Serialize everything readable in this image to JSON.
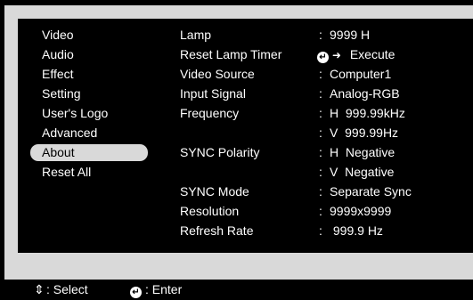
{
  "menu": {
    "items": [
      {
        "label": "Video",
        "active": false
      },
      {
        "label": "Audio",
        "active": false
      },
      {
        "label": "Effect",
        "active": false
      },
      {
        "label": "Setting",
        "active": false
      },
      {
        "label": "User's Logo",
        "active": false
      },
      {
        "label": "Advanced",
        "active": false
      },
      {
        "label": "About",
        "active": true
      },
      {
        "label": "Reset All",
        "active": false
      }
    ]
  },
  "about": {
    "rows": [
      {
        "label": "Lamp",
        "value": "9999 H"
      },
      {
        "label": "Reset Lamp Timer",
        "value": "Execute"
      },
      {
        "label": "Video Source",
        "value": "Computer1"
      },
      {
        "label": "Input Signal",
        "value": "Analog-RGB"
      },
      {
        "label": "Frequency",
        "value": "H  999.99kHz"
      },
      {
        "label": "",
        "value": "V  999.99Hz"
      },
      {
        "label": "SYNC Polarity",
        "value": "H  Negative"
      },
      {
        "label": "",
        "value": "V  Negative"
      },
      {
        "label": "SYNC Mode",
        "value": "Separate Sync"
      },
      {
        "label": "Resolution",
        "value": "9999x9999"
      },
      {
        "label": "Refresh Rate",
        "value": " 999.9 Hz"
      }
    ],
    "colon": ":"
  },
  "footer": {
    "select_label": ": Select",
    "enter_label": ": Enter",
    "select_icon": "up-down-arrow-icon",
    "enter_icon": "enter-button-icon"
  },
  "colors": {
    "background": "#000000",
    "panel": "#d9d9d9",
    "text": "#ffffff",
    "active_bg": "#d9d9d9",
    "active_text": "#000000"
  }
}
